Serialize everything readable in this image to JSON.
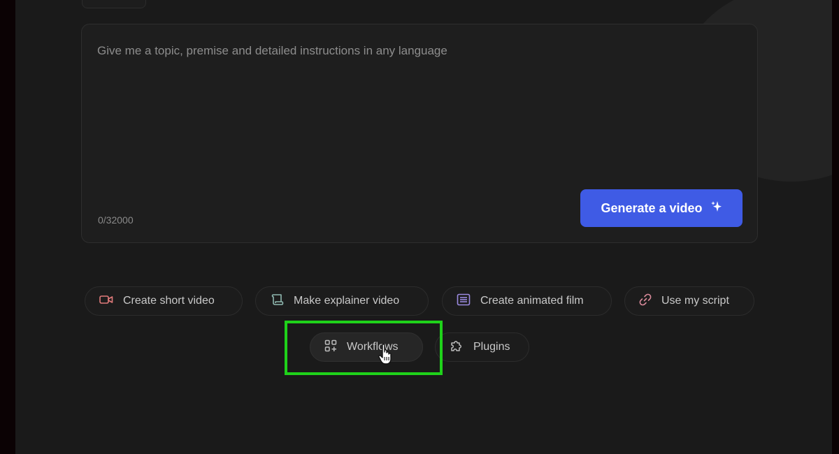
{
  "prompt": {
    "placeholder": "Give me a topic, premise and detailed instructions in any language",
    "value": "",
    "char_count": "0/32000"
  },
  "generate_button": {
    "label": "Generate a video",
    "icon": "sparkle-icon",
    "color": "#3f5be5"
  },
  "quick_actions": [
    {
      "label": "Create short video",
      "icon": "video-camera-icon"
    },
    {
      "label": "Make explainer video",
      "icon": "scroll-icon"
    },
    {
      "label": "Create animated film",
      "icon": "document-lines-icon"
    },
    {
      "label": "Use my script",
      "icon": "link-icon"
    }
  ],
  "secondary_actions": [
    {
      "label": "Workflows",
      "icon": "grid-plus-icon",
      "highlighted": true
    },
    {
      "label": "Plugins",
      "icon": "puzzle-icon"
    }
  ],
  "colors": {
    "background": "#1a1a1a",
    "highlight": "#1fd21a"
  }
}
